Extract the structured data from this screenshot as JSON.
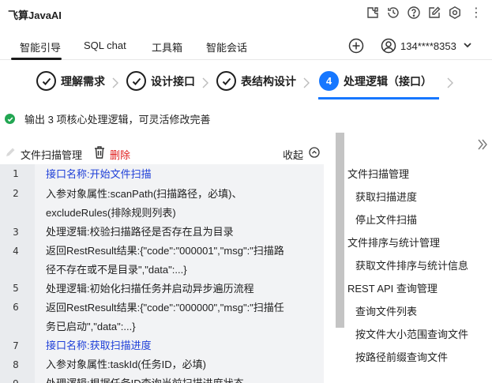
{
  "app": {
    "title": "飞算JavaAI"
  },
  "title_icons": [
    "plugin-icon",
    "history-icon",
    "help-icon",
    "edit-icon",
    "settings-icon"
  ],
  "tabs": [
    {
      "label": "智能引导",
      "active": true
    },
    {
      "label": "SQL chat",
      "active": false
    },
    {
      "label": "工具箱",
      "active": false
    },
    {
      "label": "智能会话",
      "active": false
    }
  ],
  "user": {
    "label": "134****8353"
  },
  "steps": [
    {
      "label": "理解需求",
      "status": "done"
    },
    {
      "label": "设计接口",
      "status": "done"
    },
    {
      "label": "表结构设计",
      "status": "done"
    },
    {
      "number": "4",
      "label": "处理逻辑（接口）",
      "status": "active"
    }
  ],
  "status": {
    "text": "输出 3 项核心处理逻辑，可灵活修改完善",
    "color": "#22a652"
  },
  "left_panel": {
    "title": "文件扫描管理",
    "delete_label": "删除",
    "collapse_label": "收起"
  },
  "code_lines": [
    {
      "num": "1",
      "text": [
        "接口名称:开始文件扫描"
      ],
      "blue": true
    },
    {
      "num": "2",
      "text": [
        "入参对象属性:scanPath(扫描路径，必填)、",
        "excludeRules(排除规则列表)"
      ],
      "blue": false
    },
    {
      "num": "3",
      "text": [
        "处理逻辑:校验扫描路径是否存在且为目录"
      ],
      "blue": false
    },
    {
      "num": "4",
      "text": [
        "返回RestResult结果:{\"code\":\"000001\",\"msg\":\"扫描路",
        "径不存在或不是目录\",\"data\":...}"
      ],
      "blue": false
    },
    {
      "num": "5",
      "text": [
        "处理逻辑:初始化扫描任务并启动异步遍历流程"
      ],
      "blue": false
    },
    {
      "num": "6",
      "text": [
        "返回RestResult结果:{\"code\":\"000000\",\"msg\":\"扫描任",
        "务已启动\",\"data\":...}"
      ],
      "blue": false
    },
    {
      "num": "7",
      "text": [
        "接口名称:获取扫描进度"
      ],
      "blue": true
    },
    {
      "num": "8",
      "text": [
        "入参对象属性:taskId(任务ID，必填)"
      ],
      "blue": false
    },
    {
      "num": "9",
      "text": [
        "处理逻辑:根据任务ID查询当前扫描进度状态"
      ],
      "blue": false
    }
  ],
  "nav": [
    {
      "label": "文件扫描管理",
      "level": 0
    },
    {
      "label": "获取扫描进度",
      "level": 1
    },
    {
      "label": "停止文件扫描",
      "level": 1
    },
    {
      "label": "文件排序与统计管理",
      "level": 0
    },
    {
      "label": "获取文件排序与统计信息",
      "level": 1
    },
    {
      "label": "REST API 查询管理",
      "level": 0
    },
    {
      "label": "查询文件列表",
      "level": 1
    },
    {
      "label": "按文件大小范围查询文件",
      "level": 1
    },
    {
      "label": "按路径前缀查询文件",
      "level": 1
    }
  ],
  "colors": {
    "accent": "#1677ff",
    "link_blue": "#1e3fd8",
    "danger": "#e02020",
    "success": "#22a652"
  }
}
